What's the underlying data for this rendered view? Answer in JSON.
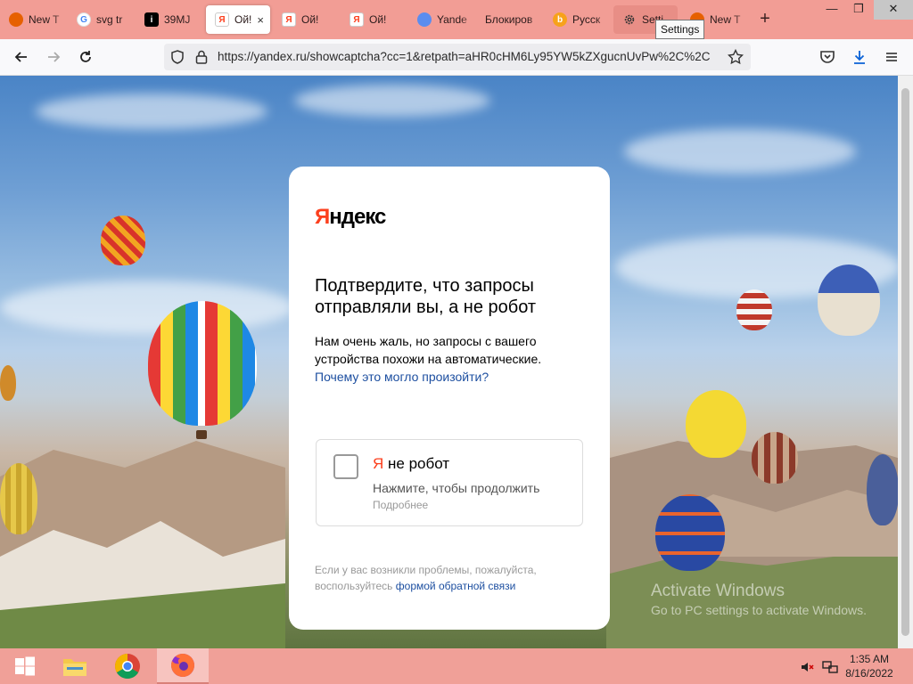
{
  "browser": {
    "tabs": [
      {
        "label": "New T",
        "icon": "firefox-icon",
        "color": "#e66000"
      },
      {
        "label": "svg tr",
        "icon": "google-icon",
        "color": "#4285f4"
      },
      {
        "label": "39MJ",
        "icon": "instagram-icon",
        "color": "#000000"
      },
      {
        "label": "Ой!",
        "icon": "yandex-icon",
        "color": "#fc3f1d",
        "active": true,
        "close": "×"
      },
      {
        "label": "Ой!",
        "icon": "yandex-icon",
        "color": "#fc3f1d"
      },
      {
        "label": "Ой!",
        "icon": "yandex-icon",
        "color": "#fc3f1d"
      },
      {
        "label": "Yande",
        "icon": "yandex-browser-icon",
        "color": "#5b8def"
      },
      {
        "label": "Блокиров",
        "icon": "blank-icon",
        "color": "#f29d95"
      },
      {
        "label": "Русск",
        "icon": "bing-icon",
        "color": "#f7a21b"
      },
      {
        "label": "Setti",
        "icon": "gear-icon",
        "color": "#333333",
        "hover": true
      },
      {
        "label": "New T",
        "icon": "firefox-icon",
        "color": "#e66000"
      }
    ],
    "new_tab": "+",
    "window_controls": {
      "minimize": "—",
      "restore": "❐",
      "close": "✕"
    },
    "tooltip": "Settings",
    "url": "https://yandex.ru/showcaptcha?cc=1&retpath=aHR0cHM6Ly95YW5kZXgucnUvPw%2C%2C"
  },
  "captcha": {
    "logo_ya": "Я",
    "logo_rest": "ндекс",
    "headline": "Подтвердите, что запросы отправляли вы, а не робот",
    "description": "Нам очень жаль, но запросы с вашего устройства похожи на автоматические.",
    "why_link": "Почему это могло произойти?",
    "robot_ya": "Я",
    "robot_rest": " не робот",
    "robot_hint": "Нажмите, чтобы продолжить",
    "robot_more": "Подробнее",
    "footer_text": "Если у вас возникли проблемы, пожалуйста, воспользуйтесь",
    "footer_link": "формой обратной связи"
  },
  "watermark": {
    "line1": "Activate Windows",
    "line2": "Go to PC settings to activate Windows."
  },
  "taskbar": {
    "time": "1:35 AM",
    "date": "8/16/2022"
  },
  "colors": {
    "yandex_red": "#fc3f1d",
    "link_blue": "#1d4fa0",
    "tabstrip": "#f29d95"
  }
}
